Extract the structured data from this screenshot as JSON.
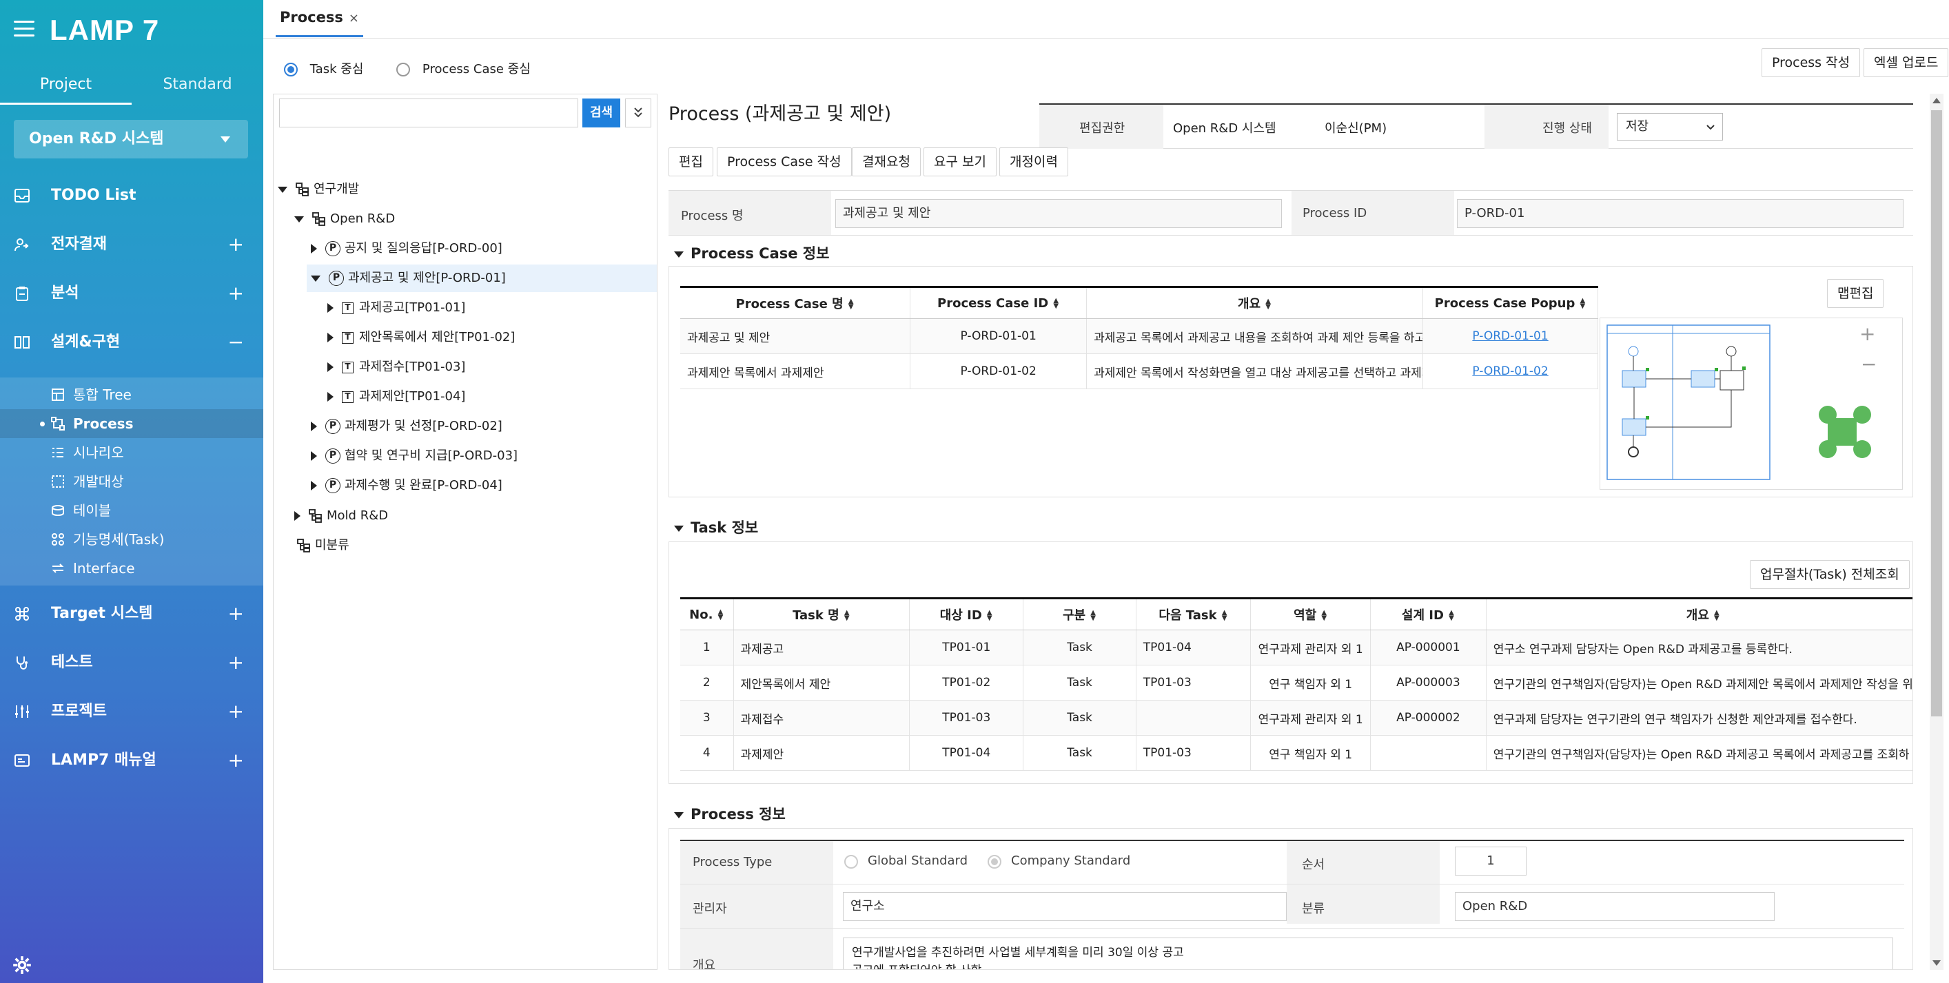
{
  "app": {
    "logo": "LAMP 7"
  },
  "sidebar": {
    "tabs": [
      "Project",
      "Standard"
    ],
    "project_select": "Open R&D 시스템",
    "nav": [
      {
        "label": "TODO List",
        "toggle": ""
      },
      {
        "label": "전자결재",
        "toggle": "+"
      },
      {
        "label": "분석",
        "toggle": "+"
      },
      {
        "label": "설계&구현",
        "toggle": "−"
      }
    ],
    "sub": [
      "통합 Tree",
      "Process",
      "시나리오",
      "개발대상",
      "테이블",
      "기능명세(Task)",
      "Interface"
    ],
    "nav2": [
      {
        "label": "Target 시스템",
        "toggle": "+"
      },
      {
        "label": "테스트",
        "toggle": "+"
      },
      {
        "label": "프로젝트",
        "toggle": "+"
      },
      {
        "label": "LAMP7 매뉴얼",
        "toggle": "+"
      }
    ]
  },
  "tab": {
    "label": "Process",
    "close": "×"
  },
  "view_mode": {
    "task": "Task 중심",
    "process_case": "Process Case 중심"
  },
  "top_buttons": {
    "create": "Process 작성",
    "upload": "엑셀 업로드"
  },
  "search": {
    "button": "검색",
    "placeholder": ""
  },
  "tree": [
    {
      "label": "연구개발"
    },
    {
      "label": "Open R&D"
    },
    {
      "label": "공지 및 질의응답[P-ORD-00]"
    },
    {
      "label": "과제공고 및 제안[P-ORD-01]"
    },
    {
      "label": "과제공고[TP01-01]"
    },
    {
      "label": "제안목록에서 제안[TP01-02]"
    },
    {
      "label": "과제접수[TP01-03]"
    },
    {
      "label": "과제제안[TP01-04]"
    },
    {
      "label": "과제평가 및 선정[P-ORD-02]"
    },
    {
      "label": "협약 및 연구비 지급[P-ORD-03]"
    },
    {
      "label": "과제수행 및 완료[P-ORD-04]"
    },
    {
      "label": "Mold R&D"
    },
    {
      "label": "미분류"
    }
  ],
  "detail": {
    "title": "Process (과제공고 및 제안)",
    "edit_auth_label": "편집권한",
    "edit_auth_value": "Open R&D 시스템",
    "owner": "이순신(PM)",
    "status_label": "진행 상태",
    "status_value": "저장",
    "actions": [
      "편집",
      "Process Case 작성",
      "결재요청",
      "요구 보기",
      "개정이력"
    ],
    "process_name_label": "Process 명",
    "process_name_value": "과제공고 및 제안",
    "process_id_label": "Process ID",
    "process_id_value": "P-ORD-01"
  },
  "process_case": {
    "title": "Process Case 정보",
    "map_edit": "맵편집",
    "zoom_in": "+",
    "zoom_out": "−",
    "columns": [
      "Process Case 명",
      "Process Case ID",
      "개요",
      "Process Case Popup"
    ],
    "rows": [
      [
        "과제공고 및 제안",
        "P-ORD-01-01",
        "과제공고 목록에서 과제공고 내용을 조회하여 과제 제안 등록을 하고 제출하면",
        "P-ORD-01-01"
      ],
      [
        "과제제안 목록에서 과제제안",
        "P-ORD-01-02",
        "과제제안 목록에서 작성화면을 열고 대상 과제공고를 선택하고 과제제안 내용",
        "P-ORD-01-02"
      ]
    ]
  },
  "task": {
    "title": "Task 정보",
    "view_all": "업무절차(Task) 전체조회",
    "columns": [
      "No.",
      "Task 명",
      "대상 ID",
      "구분",
      "다음 Task",
      "역할",
      "설계 ID",
      "개요"
    ],
    "rows": [
      [
        "1",
        "과제공고",
        "TP01-01",
        "Task",
        "TP01-04",
        "연구과제 관리자 외 1",
        "AP-000001",
        "연구소 연구과제 담당자는 Open R&D 과제공고를 등록한다."
      ],
      [
        "2",
        "제안목록에서 제안",
        "TP01-02",
        "Task",
        "TP01-03",
        "연구 책임자 외 1",
        "AP-000003",
        "연구기관의 연구책임자(담당자)는 Open R&D 과제제안 목록에서 과제제안 작성을 위"
      ],
      [
        "3",
        "과제접수",
        "TP01-03",
        "Task",
        "",
        "연구과제 관리자 외 1",
        "AP-000002",
        "연구과제 담당자는 연구기관의 연구 책임자가 신청한 제안과제를 접수한다."
      ],
      [
        "4",
        "과제제안",
        "TP01-04",
        "Task",
        "TP01-03",
        "연구 책임자 외 1",
        "",
        "연구기관의 연구책임자(담당자)는 Open R&D 과제공고 목록에서 과제공고를 조회하"
      ]
    ]
  },
  "process_info": {
    "title": "Process 정보",
    "type_label": "Process Type",
    "type_global": "Global Standard",
    "type_company": "Company Standard",
    "order_label": "순서",
    "order_value": "1",
    "manager_label": "관리자",
    "manager_value": "연구소",
    "category_label": "분류",
    "category_value": "Open R&D",
    "summary_label": "개요",
    "summary_line1": "연구개발사업을 추진하려면 사업별 세부계획을 미리 30일 이상 공고",
    "summary_line2": "공고에 포함되어야 할 사항"
  }
}
